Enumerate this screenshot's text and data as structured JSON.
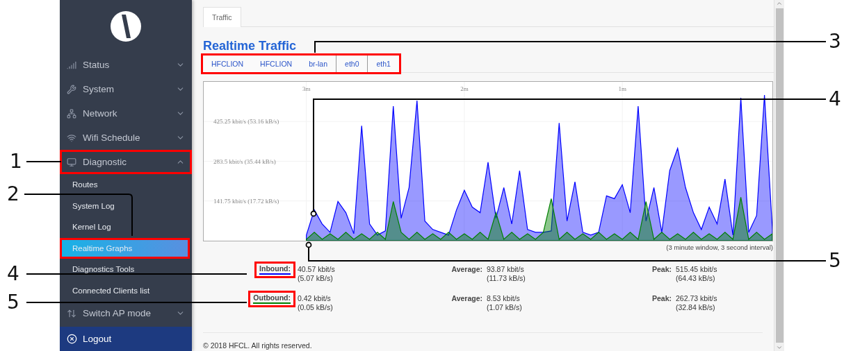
{
  "sidebar": {
    "items": [
      {
        "label": "Status",
        "expanded": false
      },
      {
        "label": "System",
        "expanded": false
      },
      {
        "label": "Network",
        "expanded": false
      },
      {
        "label": "Wifi Schedule",
        "expanded": false
      },
      {
        "label": "Diagnostic",
        "expanded": true,
        "highlighted": true,
        "children": [
          {
            "label": "Routes",
            "selected": false,
            "highlighted": false
          },
          {
            "label": "System Log",
            "selected": false,
            "highlighted": false
          },
          {
            "label": "Kernel Log",
            "selected": false,
            "highlighted": false
          },
          {
            "label": "Realtime Graphs",
            "selected": true,
            "highlighted": true
          },
          {
            "label": "Diagnostics Tools",
            "selected": false,
            "highlighted": false
          },
          {
            "label": "Connected Clients list",
            "selected": false,
            "highlighted": false
          }
        ]
      },
      {
        "label": "Switch AP mode",
        "expanded": false
      }
    ],
    "logout": "Logout"
  },
  "page_tabs": [
    {
      "label": "Traffic",
      "selected": true
    }
  ],
  "title": "Realtime Traffic",
  "interface_tabs": {
    "highlighted": true,
    "items": [
      {
        "label": "HFCLION",
        "kind": "plain"
      },
      {
        "label": "HFCLION",
        "kind": "plain"
      },
      {
        "label": "br-lan",
        "kind": "plain"
      },
      {
        "label": "eth0",
        "kind": "boxed"
      },
      {
        "label": "eth1",
        "kind": "boxed"
      }
    ]
  },
  "chart": {
    "caption": "(3 minute window, 3 second interval)",
    "x_labels": [
      "3m",
      "2m",
      "1m"
    ],
    "y_labels": [
      "425.25 kbit/s (53.16 kB/s)",
      "283.5 kbit/s (35.44 kB/s)",
      "141.75 kbit/s (17.72 kB/s)"
    ]
  },
  "stats": [
    {
      "label": "Inbound:",
      "color": "#0000ff",
      "highlighted": true,
      "current": [
        "40.57 kbit/s",
        "(5.07 kB/s)"
      ],
      "average_label": "Average:",
      "average": [
        "93.87 kbit/s",
        "(11.73 kB/s)"
      ],
      "peak_label": "Peak:",
      "peak": [
        "515.45 kbit/s",
        "(64.43 kB/s)"
      ]
    },
    {
      "label": "Outbound:",
      "color": "#008000",
      "highlighted": true,
      "current": [
        "0.42 kbit/s",
        "(0.05 kB/s)"
      ],
      "average_label": "Average:",
      "average": [
        "8.53 kbit/s",
        "(1.07 kB/s)"
      ],
      "peak_label": "Peak:",
      "peak": [
        "262.73 kbit/s",
        "(32.84 kB/s)"
      ]
    }
  ],
  "footer": "© 2018 HFCL. All rights reserved.",
  "callouts": [
    {
      "number": "1"
    },
    {
      "number": "2"
    },
    {
      "number": "3"
    },
    {
      "number": "4"
    },
    {
      "number": "5"
    },
    {
      "number": "4"
    },
    {
      "number": "5"
    }
  ]
}
